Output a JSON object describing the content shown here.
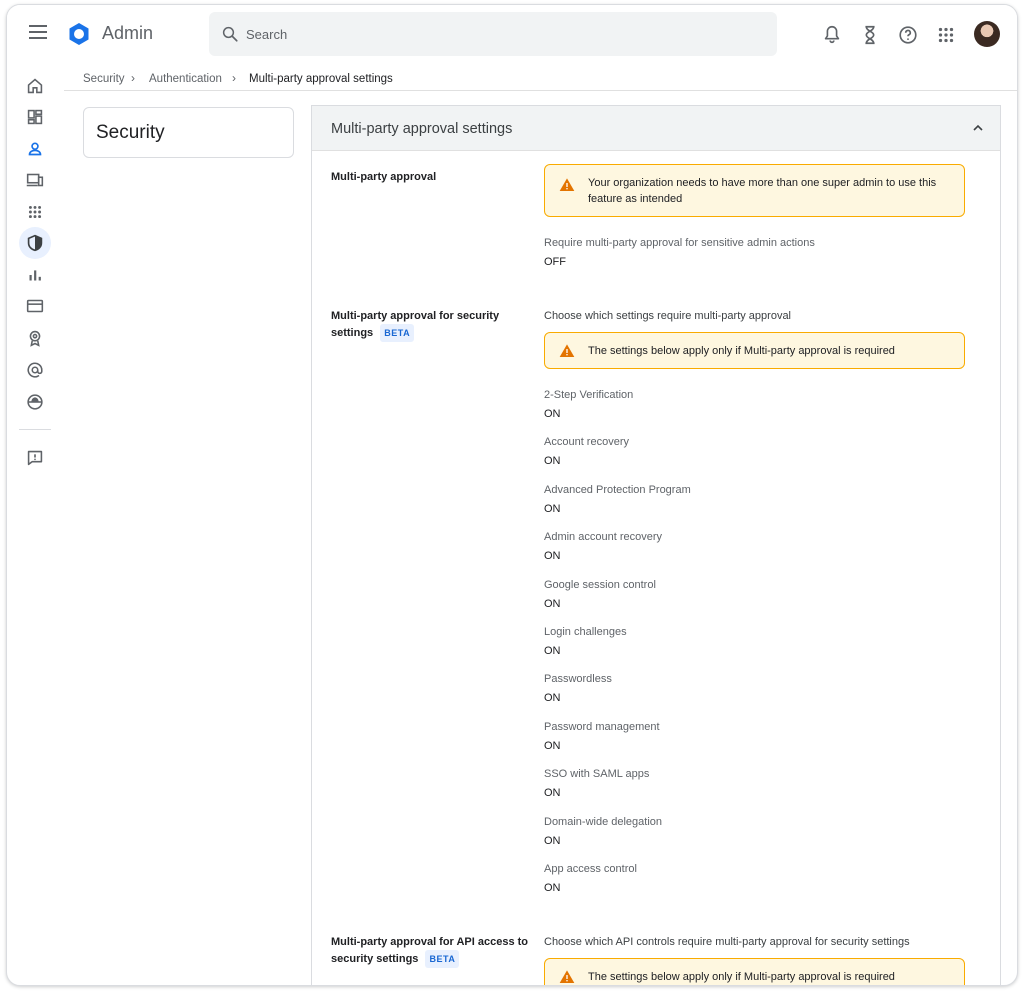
{
  "header": {
    "app_title": "Admin",
    "search_placeholder": "Search",
    "icons": [
      "menu-icon",
      "notifications-icon",
      "hourglass-icon",
      "help-icon",
      "apps-grid-icon",
      "avatar"
    ]
  },
  "breadcrumb": [
    "Security",
    "Authentication",
    "Multi-party approval settings"
  ],
  "rail": [
    "home-icon",
    "dashboard-icon",
    "users-icon",
    "devices-icon",
    "apps-icon",
    "security-shield-icon",
    "reports-icon",
    "billing-icon",
    "rules-icon",
    "email-at-icon",
    "domain-globe-icon",
    "feedback-icon"
  ],
  "left_card": {
    "title": "Security"
  },
  "panel": {
    "title": "Multi-party approval settings",
    "sections": [
      {
        "label": "Multi-party approval",
        "warning": "Your organization needs to have more than one super admin to use this feature as intended",
        "setting": {
          "name": "Require multi-party approval for sensitive admin actions",
          "value": "OFF"
        }
      },
      {
        "label": "Multi-party approval for security settings",
        "badge": "BETA",
        "description": "Choose which settings require multi-party approval",
        "warning": "The settings below apply only if Multi-party approval is required",
        "settings": [
          {
            "name": "2-Step Verification",
            "value": "ON"
          },
          {
            "name": "Account recovery",
            "value": "ON"
          },
          {
            "name": "Advanced Protection Program",
            "value": "ON"
          },
          {
            "name": "Admin account recovery",
            "value": "ON"
          },
          {
            "name": "Google session control",
            "value": "ON"
          },
          {
            "name": "Login challenges",
            "value": "ON"
          },
          {
            "name": "Passwordless",
            "value": "ON"
          },
          {
            "name": "Password management",
            "value": "ON"
          },
          {
            "name": "SSO with SAML apps",
            "value": "ON"
          },
          {
            "name": "Domain-wide delegation",
            "value": "ON"
          },
          {
            "name": "App access control",
            "value": "ON"
          }
        ]
      },
      {
        "label": "Multi-party approval for API access to security settings",
        "badge": "BETA",
        "description": "Choose which API controls require multi-party approval for security settings",
        "warning": "The settings below apply only if Multi-party approval is required"
      }
    ]
  },
  "colors": {
    "accent": "#1a73e8",
    "warning_bg": "#fef7e0",
    "warning_border": "#f9ab00",
    "active_rail": "#e8f0fe"
  }
}
